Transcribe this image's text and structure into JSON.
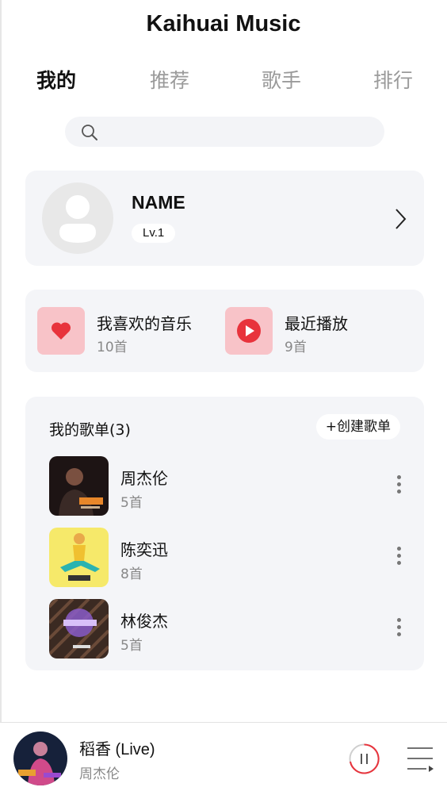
{
  "app": {
    "title": "Kaihuai Music"
  },
  "tabs": [
    {
      "label": "我的",
      "active": true
    },
    {
      "label": "推荐",
      "active": false
    },
    {
      "label": "歌手",
      "active": false
    },
    {
      "label": "排行",
      "active": false
    }
  ],
  "search": {
    "placeholder": "",
    "icon": "search-icon"
  },
  "profile": {
    "name": "NAME",
    "level": "Lv.1",
    "avatar_icon": "user-avatar-icon"
  },
  "quick": [
    {
      "title": "我喜欢的音乐",
      "count": "10首",
      "icon": "heart-icon"
    },
    {
      "title": "最近播放",
      "count": "9首",
      "icon": "play-circle-icon"
    }
  ],
  "playlists": {
    "header": "我的歌单(3)",
    "create_label": "+创建歌单",
    "items": [
      {
        "title": "周杰伦",
        "count": "5首"
      },
      {
        "title": "陈奕迅",
        "count": "8首"
      },
      {
        "title": "林俊杰",
        "count": "5首"
      }
    ]
  },
  "player": {
    "song": "稻香 (Live)",
    "artist": "周杰伦",
    "state": "playing"
  },
  "colors": {
    "accent": "#e8333c",
    "icon_bg": "#f8c3c8",
    "card_bg": "#f4f5f8"
  }
}
